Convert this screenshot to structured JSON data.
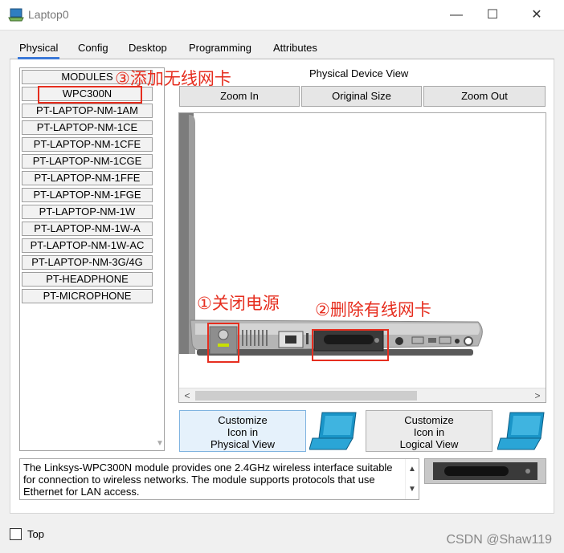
{
  "window": {
    "title": "Laptop0",
    "minimize_glyph": "—",
    "maximize_glyph": "☐",
    "close_glyph": "✕"
  },
  "tabs": [
    {
      "label": "Physical",
      "active": true
    },
    {
      "label": "Config"
    },
    {
      "label": "Desktop"
    },
    {
      "label": "Programming"
    },
    {
      "label": "Attributes"
    }
  ],
  "modules": {
    "header": "MODULES",
    "items": [
      "WPC300N",
      "PT-LAPTOP-NM-1AM",
      "PT-LAPTOP-NM-1CE",
      "PT-LAPTOP-NM-1CFE",
      "PT-LAPTOP-NM-1CGE",
      "PT-LAPTOP-NM-1FFE",
      "PT-LAPTOP-NM-1FGE",
      "PT-LAPTOP-NM-1W",
      "PT-LAPTOP-NM-1W-A",
      "PT-LAPTOP-NM-1W-AC",
      "PT-LAPTOP-NM-3G/4G",
      "PT-HEADPHONE",
      "PT-MICROPHONE"
    ]
  },
  "device_view": {
    "title": "Physical Device View",
    "zoom_in": "Zoom In",
    "original_size": "Original Size",
    "zoom_out": "Zoom Out"
  },
  "customize_physical": {
    "line1": "Customize",
    "line2": "Icon in",
    "line3": "Physical View"
  },
  "customize_logical": {
    "line1": "Customize",
    "line2": "Icon in",
    "line3": "Logical View"
  },
  "description": "The Linksys-WPC300N module provides one 2.4GHz wireless interface suitable for connection to wireless networks. The module supports protocols that use Ethernet for LAN access.",
  "top_checkbox": {
    "label": "Top",
    "checked": false
  },
  "annotations": {
    "step1": "①关闭电源",
    "step2": "②删除有线网卡",
    "step3": "③添加无线网卡"
  },
  "watermark": "CSDN @Shaw119",
  "colors": {
    "annotation": "#e62e1f",
    "tab_accent": "#3a78d8",
    "laptop_icon": "#1a95c8"
  },
  "icons": {
    "app": "laptop-app-icon",
    "customize": "laptop-icon",
    "scroll_left": "chevron-left-icon",
    "scroll_right": "chevron-right-icon"
  }
}
